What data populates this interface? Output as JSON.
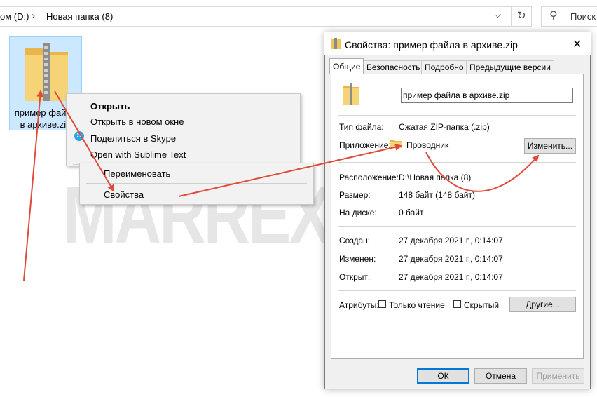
{
  "explorer": {
    "breadcrumbs": [
      "ом (D:)",
      "Новая папка (8)"
    ],
    "search_placeholder": "Поиск",
    "selected_file": {
      "name": "пример файла в архиве.zip",
      "label": "пример файла в архиве.zip"
    }
  },
  "context_menu": {
    "items": [
      "Открыть",
      "Открыть в новом окне",
      "Поделиться в Skype",
      "Open with Sublime Text",
      "Переименовать",
      "Свойства"
    ]
  },
  "watermark": "MARREX.RU",
  "dialog": {
    "title": "Свойства: пример файла в архиве.zip",
    "tabs": [
      "Общие",
      "Безопасность",
      "Подробно",
      "Предыдущие версии"
    ],
    "active_tab": "Общие",
    "file_name": "пример файла в архиве.zip",
    "fields": {
      "type_label": "Тип файла:",
      "type_value": "Сжатая ZIP-папка (.zip)",
      "app_label": "Приложение:",
      "app_value": "Проводник",
      "change_button": "Изменить...",
      "location_label": "Расположение:",
      "location_value": "D:\\Новая папка (8)",
      "size_label": "Размер:",
      "size_value": "148 байт (148 байт)",
      "disk_label": "На диске:",
      "disk_value": "0 байт",
      "created_label": "Создан:",
      "created_value": "27 декабря 2021 г., 0:14:07",
      "modified_label": "Изменен:",
      "modified_value": "27 декабря 2021 г., 0:14:07",
      "opened_label": "Открыт:",
      "opened_value": "27 декабря 2021 г., 0:14:07"
    },
    "attributes": {
      "label": "Атрибуты:",
      "readonly": "Только чтение",
      "hidden": "Скрытый",
      "other_button": "Другие..."
    },
    "buttons": {
      "ok": "ОК",
      "cancel": "Отмена",
      "apply": "Применить"
    }
  },
  "colors": {
    "selection": "#cce8ff",
    "annotation_arrow": "#e04a3a",
    "primary_border": "#0078d7"
  }
}
